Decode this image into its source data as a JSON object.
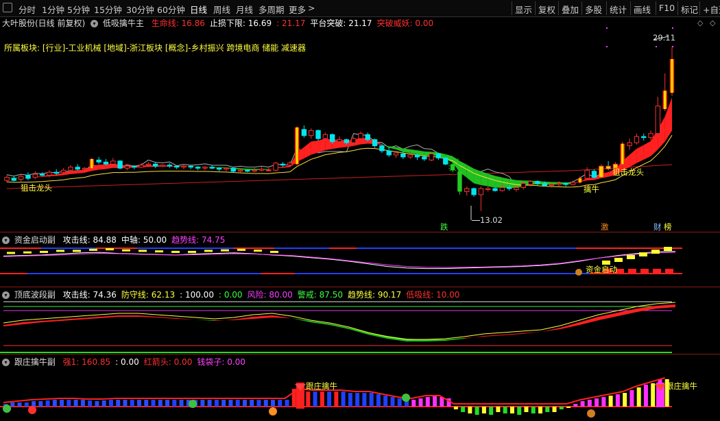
{
  "toolbar": {
    "left": [
      "分时",
      "1分钟",
      "5分钟",
      "15分钟",
      "30分钟",
      "60分钟",
      "日线",
      "周线",
      "月线",
      "多周期",
      "更多"
    ],
    "more_arrow": ">",
    "right": [
      "显示",
      "复权",
      "叠加",
      "多股",
      "统计",
      "画线",
      "F10",
      "标记",
      "+自选"
    ],
    "active": "日线"
  },
  "main_header": {
    "stock": "大叶股份(日线 前复权)",
    "indicator": "低吸擒牛主",
    "items": [
      {
        "label": "生命线: ",
        "value": "16.86",
        "color": "#ff3030"
      },
      {
        "label": "止损下限: ",
        "value": "16.69",
        "color": "#ffffff"
      },
      {
        "label": "",
        "value": ": 21.17",
        "color": "#ff3030"
      },
      {
        "label": "平台突破: ",
        "value": "21.17",
        "color": "#ffffff"
      },
      {
        "label": "突破威妖: ",
        "value": "0.00",
        "color": "#ff3030"
      }
    ]
  },
  "sector_line": "所属板块: [行业]-工业机械 [地域]-浙江板块 [概念]-乡村振兴 跨境电商 储能 减速器",
  "annotations": {
    "high": "29.11",
    "low": "13.02",
    "dragon_left": "狙击龙头",
    "dragon_right": "狙击龙头",
    "capture": "擒牛",
    "mark_die": "跌",
    "mark_ji": "激",
    "mark_cai": "财",
    "mark_bang": "榜",
    "fund_start": "资金启动",
    "follow_1": "跟庄擒牛",
    "follow_2": "跟庄擒牛"
  },
  "panel2": {
    "title": "资金启动副",
    "items": [
      {
        "label": "攻击线: ",
        "value": "84.88",
        "color": "#ffffff"
      },
      {
        "label": "中轴: ",
        "value": "50.00",
        "color": "#ffffff"
      },
      {
        "label": "趋势线: ",
        "value": "74.75",
        "color": "#ff40ff"
      }
    ]
  },
  "panel3": {
    "title": "顶底波段副",
    "items": [
      {
        "label": "攻击线: ",
        "value": "74.36",
        "color": "#ffffff"
      },
      {
        "label": "防守线: ",
        "value": "62.13",
        "color": "#ffff40"
      },
      {
        "label": "",
        "value": ": 100.00",
        "color": "#ffffff"
      },
      {
        "label": "",
        "value": ": 0.00",
        "color": "#40ff40"
      },
      {
        "label": "风险: ",
        "value": "80.00",
        "color": "#ff40ff"
      },
      {
        "label": "警戒: ",
        "value": "87.50",
        "color": "#40ff40"
      },
      {
        "label": "趋势线: ",
        "value": "90.17",
        "color": "#ffff40"
      },
      {
        "label": "低吸线: ",
        "value": "10.00",
        "color": "#ff3030"
      }
    ]
  },
  "panel4": {
    "title": "跟庄擒牛副",
    "items": [
      {
        "label": "强1: ",
        "value": "160.85",
        "color": "#ff3030"
      },
      {
        "label": "",
        "value": ": 0.00",
        "color": "#ffffff"
      },
      {
        "label": "红箭头: ",
        "value": "0.00",
        "color": "#ff3030"
      },
      {
        "label": "钱袋子: ",
        "value": "0.00",
        "color": "#ff40ff"
      }
    ]
  },
  "colors": {
    "up": "#ff3030",
    "down": "#00e5ee",
    "green": "#22cc22",
    "yellow": "#ffff00",
    "magenta": "#ff40ff"
  }
}
